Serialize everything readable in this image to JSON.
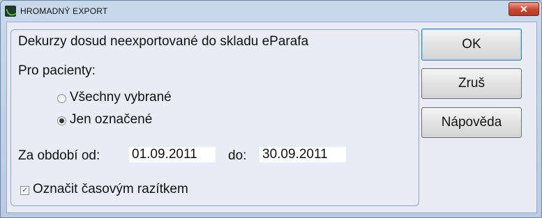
{
  "window": {
    "title": "HROMADNÝ EXPORT",
    "close_glyph": "✕"
  },
  "group": {
    "heading": "Dekurzy dosud neexportované do skladu eParafa",
    "patients_label": "Pro pacienty:",
    "radio_all": {
      "label": "Všechny vybrané",
      "checked": false
    },
    "radio_marked": {
      "label": "Jen označené",
      "checked": true
    },
    "period_from_label": "Za období od:",
    "date_from": "01.09.2011",
    "period_to_label": "do:",
    "date_to": "30.09.2011",
    "timestamp": {
      "label": "Označit časovým razítkem",
      "checked": true,
      "glyph": "✓"
    }
  },
  "buttons": {
    "ok": "OK",
    "cancel": "Zruš",
    "help": "Nápověda"
  },
  "icons": {
    "app": "app-logo-icon",
    "close": "close-icon"
  }
}
